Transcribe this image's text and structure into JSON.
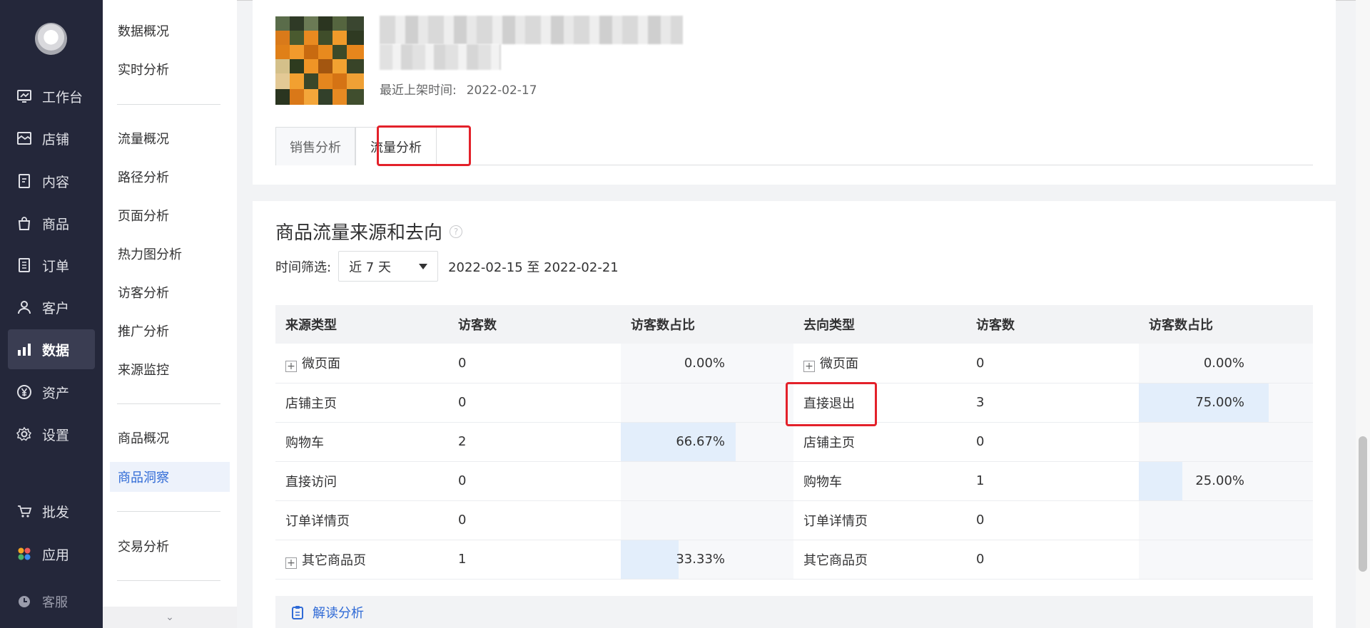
{
  "nav": {
    "items": [
      {
        "label": "工作台",
        "icon": "dashboard-icon"
      },
      {
        "label": "店铺",
        "icon": "store-icon"
      },
      {
        "label": "内容",
        "icon": "document-icon"
      },
      {
        "label": "商品",
        "icon": "bag-icon"
      },
      {
        "label": "订单",
        "icon": "order-icon"
      },
      {
        "label": "客户",
        "icon": "user-icon"
      },
      {
        "label": "数据",
        "icon": "bar-chart-icon",
        "active": true
      },
      {
        "label": "资产",
        "icon": "yen-icon"
      },
      {
        "label": "设置",
        "icon": "gear-icon"
      },
      {
        "label": "批发",
        "icon": "cart-icon"
      },
      {
        "label": "应用",
        "icon": "apps-icon"
      },
      {
        "label": "客服",
        "icon": "clock-icon"
      }
    ]
  },
  "submenu": {
    "items": [
      "数据概况",
      "实时分析",
      "流量概况",
      "路径分析",
      "页面分析",
      "热力图分析",
      "访客分析",
      "推广分析",
      "来源监控",
      "商品概况",
      "商品洞察",
      "交易分析"
    ],
    "active": "商品洞察",
    "expand": "⌄"
  },
  "product": {
    "shelf_label": "最近上架时间:",
    "shelf_date": "2022-02-17"
  },
  "tabs": [
    "销售分析",
    "流量分析"
  ],
  "section": {
    "title": "商品流量来源和去向",
    "help": "?",
    "filter_label": "时间筛选:",
    "filter_value": "近 7 天",
    "date_range": "2022-02-15 至 2022-02-21"
  },
  "table": {
    "headers": [
      "来源类型",
      "访客数",
      "访客数占比",
      "去向类型",
      "访客数",
      "访客数占比"
    ],
    "rows": [
      {
        "src": "微页面",
        "src_plus": true,
        "src_visits": "0",
        "src_pct": "0.00%",
        "src_ratio": 0,
        "dst": "微页面",
        "dst_plus": true,
        "dst_visits": "0",
        "dst_pct": "0.00%",
        "dst_ratio": 0
      },
      {
        "src": "店铺主页",
        "src_visits": "0",
        "src_pct": "",
        "src_ratio": 0,
        "dst": "直接退出",
        "dst_visits": "3",
        "dst_pct": "75.00%",
        "dst_ratio": 0.75
      },
      {
        "src": "购物车",
        "src_visits": "2",
        "src_pct": "66.67%",
        "src_ratio": 0.6667,
        "dst": "店铺主页",
        "dst_visits": "0",
        "dst_pct": "",
        "dst_ratio": 0
      },
      {
        "src": "直接访问",
        "src_visits": "0",
        "src_pct": "",
        "src_ratio": 0,
        "dst": "购物车",
        "dst_visits": "1",
        "dst_pct": "25.00%",
        "dst_ratio": 0.25
      },
      {
        "src": "订单详情页",
        "src_visits": "0",
        "src_pct": "",
        "src_ratio": 0,
        "dst": "订单详情页",
        "dst_visits": "0",
        "dst_pct": "",
        "dst_ratio": 0
      },
      {
        "src": "其它商品页",
        "src_plus": true,
        "src_visits": "1",
        "src_pct": "33.33%",
        "src_ratio": 0.3333,
        "dst": "其它商品页",
        "dst_visits": "0",
        "dst_pct": "",
        "dst_ratio": 0
      }
    ]
  },
  "interpret_label": "解读分析",
  "colors": {
    "highlight": "#e3212a",
    "accent": "#2f6ad6",
    "nav_bg": "#24273a"
  }
}
